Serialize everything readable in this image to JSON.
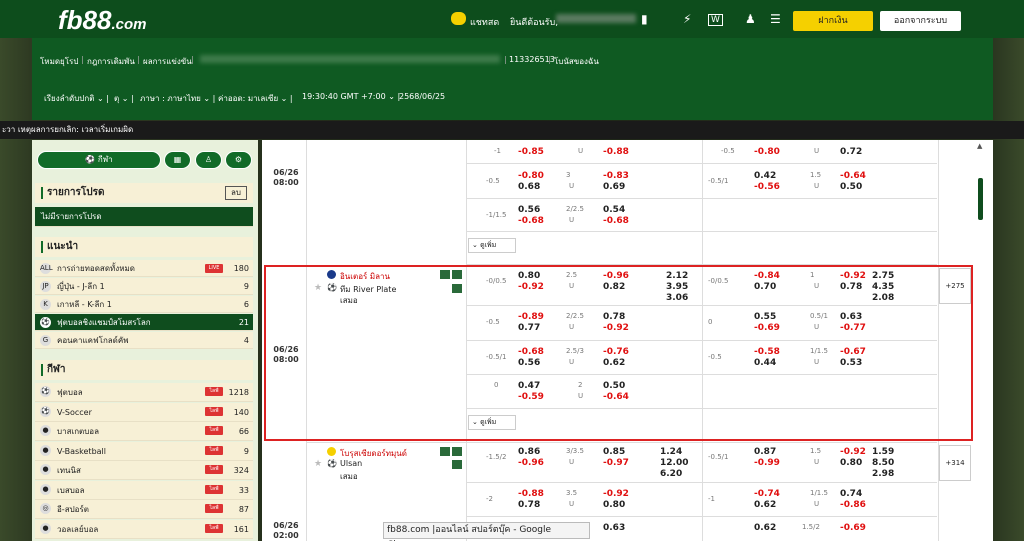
{
  "header": {
    "logo_main": "fb88",
    "logo_domain": ".com",
    "chat": "แชทสด",
    "welcome": "ยินดีต้อนรับ,",
    "deposit": "ฝากเงิน",
    "logout": "ออกจากระบบ"
  },
  "nav": {
    "links": [
      "โหมดยุโรป",
      "กฎการเดิมพัน",
      "ผลการแข่งขัน"
    ],
    "account_id": "113326513",
    "bonus": "โบนัสของฉัน",
    "settings": [
      "เรียงลำดับปกติ",
      "ตุ",
      "ภาษา : ภาษาไทย",
      "ค่าออด: มาเลเซีย",
      "19:30:40 GMT +7:00",
      "2568/06/25"
    ]
  },
  "strip": "ะวา เหตุผลการยกเลิก: เวลาเริ่มเกมผิด",
  "sidebar": {
    "sport_btn": "กีฬา",
    "fav_title": "รายการโปรด",
    "fav_btn": "ลบ",
    "fav_empty": "ไม่มีรายการโปรด",
    "rec_title": "แนะนำ",
    "rec_items": [
      {
        "label": "การถ่ายทอดสดทั้งหมด",
        "count": "180",
        "live": "LIVE"
      },
      {
        "label": "ญี่ปุ่น - J-ลีก 1",
        "count": "9"
      },
      {
        "label": "เกาหลี - K-ลีก 1",
        "count": "6"
      },
      {
        "label": "ฟุตบอลชิงแชมป์สโมสรโลก",
        "count": "21"
      },
      {
        "label": "คอนคาแคฟโกลด์คัพ",
        "count": "4"
      }
    ],
    "sports_title": "กีฬา",
    "sports": [
      {
        "label": "ฟุตบอล",
        "count": "1218",
        "live": "ไลฟ์"
      },
      {
        "label": "V-Soccer",
        "count": "140",
        "live": "ไลฟ์"
      },
      {
        "label": "บาสเกตบอล",
        "count": "66",
        "live": "ไลฟ์"
      },
      {
        "label": "V-Basketball",
        "count": "9",
        "live": "ไลฟ์"
      },
      {
        "label": "เทนนิส",
        "count": "324",
        "live": "ไลฟ์"
      },
      {
        "label": "เบสบอล",
        "count": "33",
        "live": "ไลฟ์"
      },
      {
        "label": "อี-สปอร์ต",
        "count": "87",
        "live": "ไลฟ์"
      },
      {
        "label": "วอลเลย์บอล",
        "count": "161",
        "live": "ไลฟ์"
      }
    ]
  },
  "matches": {
    "m1": {
      "date": "06/26",
      "time": "08:00",
      "more": "ดูเพิ่ม"
    },
    "m2": {
      "date": "06/26",
      "time": "08:00",
      "home": "อินเตอร์ มิลาน",
      "away": "ทีม River Plate",
      "draw": "เสมอ",
      "plus": "+275",
      "more": "ดูเพิ่ม",
      "ft1x2": [
        "2.12",
        "3.95",
        "3.06"
      ],
      "h1x2": [
        "2.75",
        "4.35",
        "2.08"
      ]
    },
    "m3": {
      "date": "06/26",
      "time": "08:00",
      "home": "โบรุสเซียดอร์ทมุนด์",
      "away": "Ulsan",
      "draw": "เสมอ",
      "plus": "+314",
      "ft1x2": [
        "1.24",
        "12.00",
        "6.20"
      ],
      "h1x2": [
        "1.59",
        "8.50",
        "2.98"
      ]
    },
    "m4": {
      "date": "06/26",
      "time": "02:00"
    }
  },
  "odds_top": [
    {
      "hdp": "-1",
      "a": "-0.85",
      "ou": "U",
      "b": "-0.88",
      "hdp2": "-0.5",
      "c": "-0.80",
      "ou2": "U",
      "d": "0.72"
    },
    {
      "hdp": "-0.5",
      "a1": "-0.80",
      "a": "0.68",
      "ou1": "3",
      "ou": "U",
      "b1": "-0.83",
      "b": "0.69",
      "hdp2": "-0.5/1",
      "c1": "0.42",
      "c": "-0.56",
      "ou21": "1.5",
      "ou2": "U",
      "d1": "-0.64",
      "d": "0.50"
    },
    {
      "hdp": "-1/1.5",
      "a1": "0.56",
      "a": "-0.68",
      "ou1": "2/2.5",
      "ou": "U",
      "b1": "0.54",
      "b": "-0.68"
    }
  ],
  "odds_m2": [
    {
      "hdp": "-0/0.5",
      "a1": "0.80",
      "a": "-0.92",
      "ou1": "2.5",
      "ou": "U",
      "b1": "-0.96",
      "b": "0.82",
      "hdp2": "-0/0.5",
      "c1": "-0.84",
      "c": "0.70",
      "ou21": "1",
      "ou2": "U",
      "d1": "-0.92",
      "d": "0.78"
    },
    {
      "hdp": "-0.5",
      "a1": "-0.89",
      "a": "0.77",
      "ou1": "2/2.5",
      "ou": "U",
      "b1": "0.78",
      "b": "-0.92",
      "hdp2": "0",
      "c1": "0.55",
      "c": "-0.69",
      "ou21": "0.5/1",
      "ou2": "U",
      "d1": "0.63",
      "d": "-0.77"
    },
    {
      "hdp": "-0.5/1",
      "a1": "-0.68",
      "a": "0.56",
      "ou1": "2.5/3",
      "ou": "U",
      "b1": "-0.76",
      "b": "0.62",
      "hdp2": "-0.5",
      "c1": "-0.58",
      "c": "0.44",
      "ou21": "1/1.5",
      "ou2": "U",
      "d1": "-0.67",
      "d": "0.53"
    },
    {
      "hdp": "0",
      "a1": "0.47",
      "a": "-0.59",
      "ou1": "2",
      "ou": "U",
      "b1": "0.50",
      "b": "-0.64"
    }
  ],
  "odds_m3": [
    {
      "hdp": "-1.5/2",
      "a1": "0.86",
      "a": "-0.96",
      "ou1": "3/3.5",
      "ou": "U",
      "b1": "0.85",
      "b": "-0.97",
      "hdp2": "-0.5/1",
      "c1": "0.87",
      "c": "-0.99",
      "ou21": "1.5",
      "ou2": "U",
      "d1": "-0.92",
      "d": "0.80"
    },
    {
      "hdp": "-2",
      "a1": "-0.88",
      "a": "0.78",
      "ou1": "3.5",
      "ou": "U",
      "b1": "-0.92",
      "b": "0.80",
      "hdp2": "-1",
      "c1": "-0.74",
      "c": "0.62",
      "ou21": "1/1.5",
      "ou2": "U",
      "d1": "0.74",
      "d": "-0.86"
    },
    {
      "a": "0.63",
      "c1": "0.62",
      "ou21": "1.5/2",
      "d1": "-0.69"
    }
  ],
  "tooltip": "fb88.com |ออนไลน์ สปอร์ตบุ๊ค - Google Chrome"
}
